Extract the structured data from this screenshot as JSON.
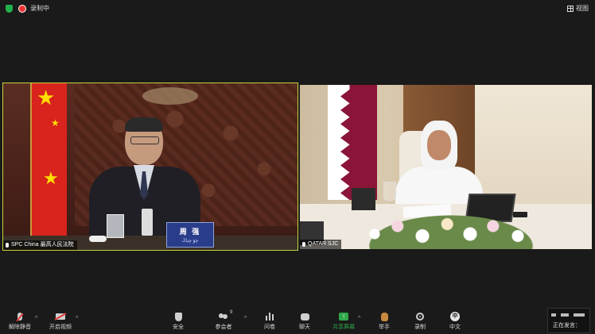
{
  "topbar": {
    "recording_label": "录制中",
    "view_label": "视图"
  },
  "tiles": {
    "left": {
      "participant_name": "SPC China 最高人民法院",
      "nameplate_main": "周 强",
      "nameplate_sub": "چۇ چياڭ"
    },
    "right": {
      "participant_name": "QATAR SJC"
    }
  },
  "toolbar": {
    "items": [
      {
        "label": "解除静音",
        "icon": "mic-muted-icon"
      },
      {
        "label": "开启视频",
        "icon": "video-off-icon"
      },
      {
        "label": "安全",
        "icon": "shield-icon"
      },
      {
        "label": "参会者",
        "icon": "participants-icon",
        "count": "9"
      },
      {
        "label": "问卷",
        "icon": "poll-icon"
      },
      {
        "label": "聊天",
        "icon": "chat-icon"
      },
      {
        "label": "共享屏幕",
        "icon": "share-screen-icon"
      },
      {
        "label": "举手",
        "icon": "raise-hand-icon"
      },
      {
        "label": "录制",
        "icon": "record-icon"
      },
      {
        "label": "中文",
        "icon": "language-icon",
        "glyph": "中"
      }
    ],
    "share_color": "#2ea84a"
  },
  "speaking": {
    "label": "正在发言："
  }
}
